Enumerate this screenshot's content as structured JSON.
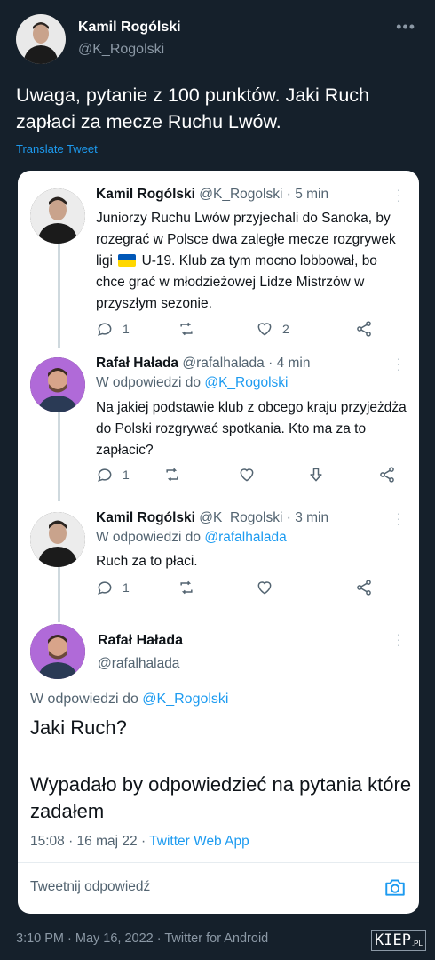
{
  "outer_tweet": {
    "name": "Kamil Rogólski",
    "handle": "@K_Rogolski",
    "text": "Uwaga, pytanie z 100 punktów. Jaki Ruch zapłaci za mecze Ruchu Lwów.",
    "translate": "Translate Tweet",
    "more": "•••",
    "footer": "3:10 PM · May 16, 2022 · Twitter for Android"
  },
  "embed": {
    "tweets": [
      {
        "name": "Kamil Rogólski",
        "handle_time": "@K_Rogolski · 5 min",
        "body_pre": "Juniorzy Ruchu Lwów przyjechali do Sanoka, by rozegrać w Polsce dwa zaległe mecze rozgrywek ligi",
        "body_post": "U-19. Klub za tym mocno lobbował, bo chce grać w młodzieżowej Lidze Mistrzów w przyszłym sezonie.",
        "reply_count": "1",
        "like_count": "2",
        "flag_colors": [
          "#0057b7",
          "#ffd700"
        ]
      },
      {
        "name": "Rafał Hałada",
        "handle_time": "@rafalhalada · 4 min",
        "reply_to_label": "W odpowiedzi do",
        "reply_to_link": "@K_Rogolski",
        "body": "Na jakiej podstawie klub z obcego kraju przyjeżdża do Polski rozgrywać spotkania. Kto ma za to zapłacic?",
        "reply_count": "1"
      },
      {
        "name": "Kamil Rogólski",
        "handle_time": "@K_Rogolski · 3 min",
        "reply_to_label": "W odpowiedzi do",
        "reply_to_link": "@rafalhalada",
        "body": "Ruch za to płaci.",
        "reply_count": "1"
      }
    ],
    "main": {
      "name": "Rafał Hałada",
      "handle": "@rafalhalada",
      "reply_to_label": "W odpowiedzi do",
      "reply_to_link": "@K_Rogolski",
      "text1": "Jaki Ruch?",
      "text2": "Wypadało by odpowiedzieć na pytania które zadałem",
      "meta_time": "15:08 · 16 maj 22 ·",
      "meta_app": "Twitter Web App"
    },
    "reply_placeholder": "Tweetnij odpowiedź"
  },
  "watermark": {
    "main": "KIEP",
    "suffix": ".PL"
  },
  "colors": {
    "background": "#15202b",
    "accent": "#1d9bf0",
    "muted": "#8b98a5",
    "card": "#ffffff"
  }
}
